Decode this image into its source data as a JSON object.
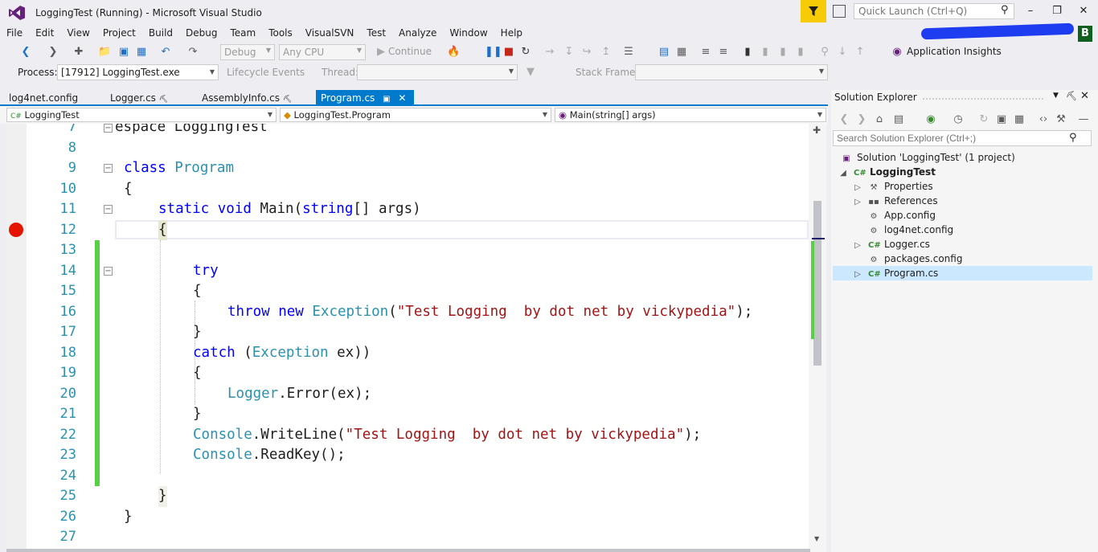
{
  "window": {
    "title": "LoggingTest (Running) - Microsoft Visual Studio",
    "quick_launch_placeholder": "Quick Launch (Ctrl+Q)",
    "user_initial": "B"
  },
  "menu": [
    "File",
    "Edit",
    "View",
    "Project",
    "Build",
    "Debug",
    "Team",
    "Tools",
    "VisualSVN",
    "Test",
    "Analyze",
    "Window",
    "Help"
  ],
  "toolbar": {
    "config": "Debug",
    "platform": "Any CPU",
    "continue": "Continue",
    "app_insights": "Application Insights"
  },
  "debug_location": {
    "process_label": "Process:",
    "process_value": "[17912] LoggingTest.exe",
    "lifecycle": "Lifecycle Events",
    "thread_label": "Thread:",
    "stack_label": "Stack Frame:"
  },
  "tabs": [
    {
      "label": "log4net.config"
    },
    {
      "label": "Logger.cs"
    },
    {
      "label": "AssemblyInfo.cs"
    },
    {
      "label": "Program.cs",
      "active": true
    }
  ],
  "navbar": {
    "project": "LoggingTest",
    "class": "LoggingTest.Program",
    "member": "Main(string[] args)"
  },
  "editor": {
    "line_numbers": [
      "7",
      "8",
      "9",
      "10",
      "11",
      "12",
      "13",
      "14",
      "15",
      "16",
      "17",
      "18",
      "19",
      "20",
      "21",
      "22",
      "23",
      "24",
      "25",
      "26",
      "27"
    ],
    "breakpoint_line": "12",
    "code": {
      "l7": "espace LoggingTest",
      "l9_kw": "class",
      "l9_name": "Program",
      "l10": "{",
      "l11_kw": "static void",
      "l11_name": "Main(",
      "l11_type": "string",
      "l11_rest": "[] args)",
      "l12": "{",
      "l14": "try",
      "l15": "{",
      "l16_kw": "throw new",
      "l16_type": "Exception",
      "l16_str": "\"Test Logging  by dot net by vickypedia\"",
      "l16_end": ");",
      "l17": "}",
      "l18_kw": "catch",
      "l18_type": "Exception",
      "l18_rest": " ex)",
      "l19": "{",
      "l20_type": "Logger",
      "l20_rest": ".Error(ex);",
      "l21": "}",
      "l22_type": "Console",
      "l22_method": ".WriteLine(",
      "l22_str": "\"Test Logging  by dot net by vickypedia\"",
      "l22_end": ");",
      "l23_type": "Console",
      "l23_rest": ".ReadKey();",
      "l25": "}",
      "l26": "}"
    }
  },
  "solution_explorer": {
    "title": "Solution Explorer",
    "search_placeholder": "Search Solution Explorer (Ctrl+;)",
    "solution": "Solution 'LoggingTest' (1 project)",
    "project": "LoggingTest",
    "items": [
      "Properties",
      "References",
      "App.config",
      "log4net.config",
      "Logger.cs",
      "packages.config",
      "Program.cs"
    ],
    "selected": "Program.cs"
  },
  "colors": {
    "accent": "#007acc",
    "keyword": "#0000ff",
    "type": "#2b91af",
    "string": "#a31515",
    "breakpoint": "#e51400",
    "changed": "#57d046"
  }
}
